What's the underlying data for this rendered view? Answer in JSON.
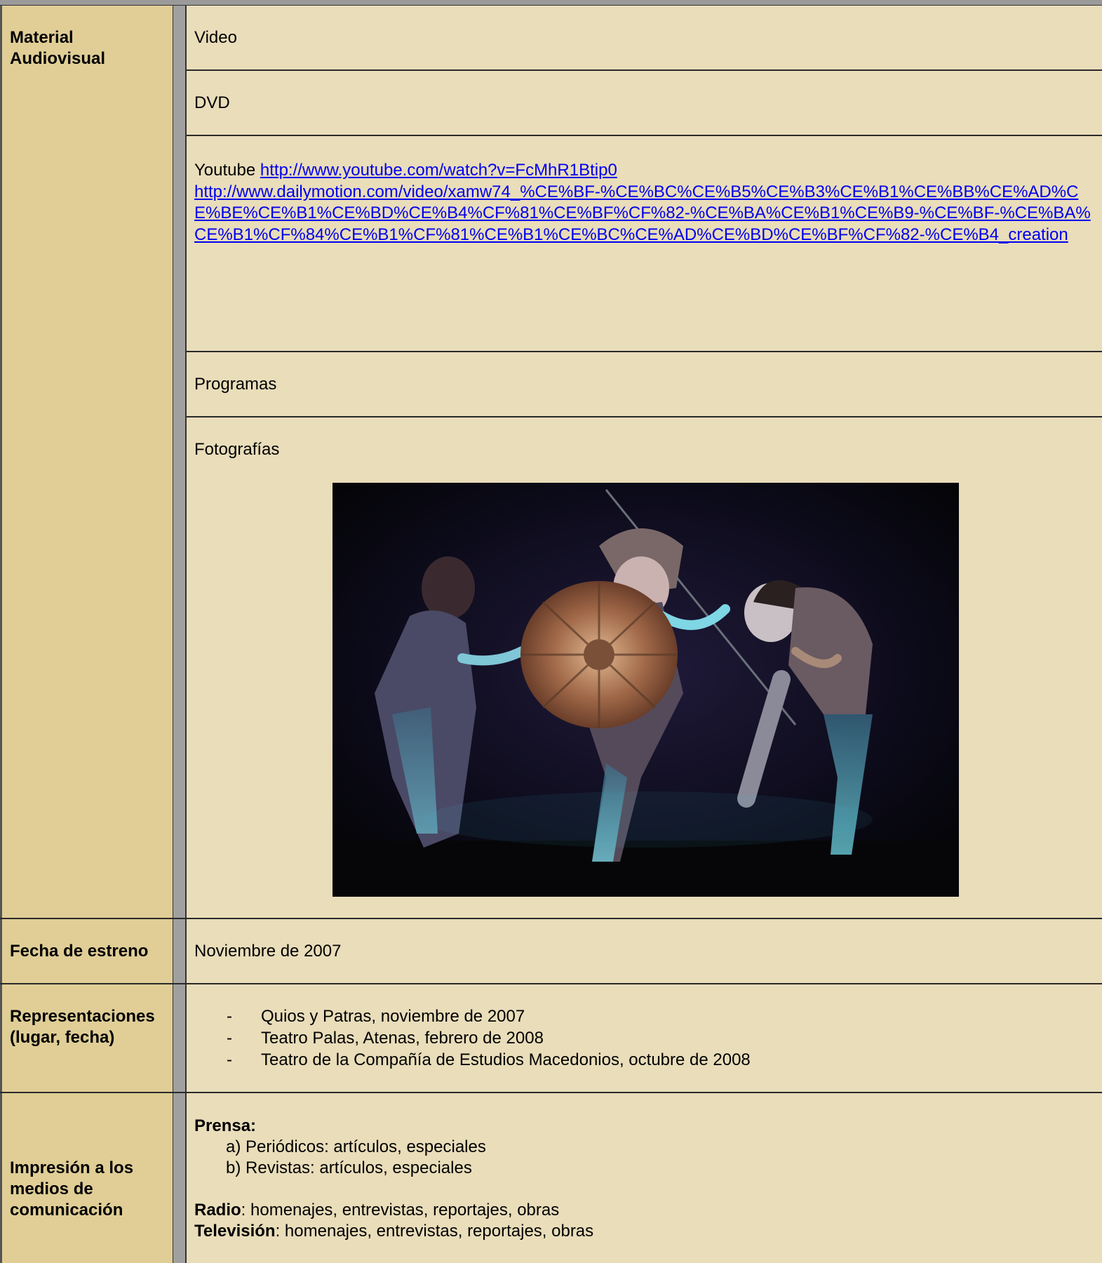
{
  "rows": {
    "material": {
      "label": "Material Audiovisual",
      "video": "Video",
      "dvd": "DVD",
      "youtube_prefix": "Youtube",
      "youtube_url": "http://www.youtube.com/watch?v=FcMhR1Btip0",
      "dailymotion_url": "http://www.dailymotion.com/video/xamw74_%CE%BF-%CE%BC%CE%B5%CE%B3%CE%B1%CE%BB%CE%AD%CE%BE%CE%B1%CE%BD%CE%B4%CF%81%CE%BF%CF%82-%CE%BA%CE%B1%CE%B9-%CE%BF-%CE%BA%CE%B1%CF%84%CE%B1%CF%81%CE%B1%CE%BC%CE%AD%CE%BD%CE%BF%CF%82-%CE%B4_creation",
      "programas": "Programas",
      "fotografias": "Fotografías"
    },
    "fecha": {
      "label": "Fecha de estreno",
      "value": "Noviembre de 2007"
    },
    "representaciones": {
      "label": "Representaciones (lugar, fecha)",
      "bullet": "-",
      "items": [
        "Quios y Patras, noviembre de 2007",
        "Teatro Palas, Atenas, febrero de 2008",
        "Teatro de la Compañía de Estudios Macedonios, octubre de 2008"
      ]
    },
    "medios": {
      "label": "Impresión a los medios de comunicación",
      "prensa_title": "Prensa:",
      "prensa_items": [
        "a) Periódicos: artículos, especiales",
        "b) Revistas: artículos, especiales"
      ],
      "radio_label": "Radio",
      "radio_text": ":  homenajes, entrevistas, reportajes, obras",
      "tv_label": "Televisión",
      "tv_text": ":  homenajes, entrevistas, reportajes, obras"
    }
  },
  "colors": {
    "content_bg": "#e9ddba",
    "label_bg": "#e0ce96",
    "divider": "#a0a0a0",
    "link": "#0000ee"
  }
}
